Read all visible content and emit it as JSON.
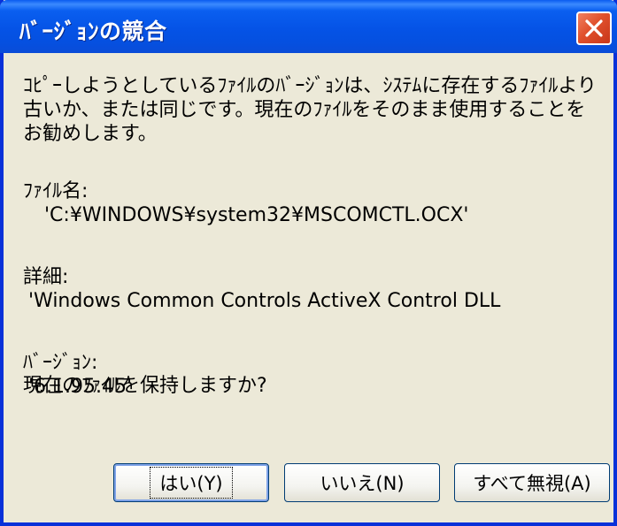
{
  "dialog": {
    "title": "ﾊﾞｰｼﾞｮﾝの競合",
    "message": "ｺﾋﾟｰしようとしているﾌｧｲﾙのﾊﾞｰｼﾞｮﾝは、ｼｽﾃﾑに存在するﾌｧｲﾙより古いか、または同じです。現在のﾌｧｲﾙをそのまま使用することをお勧めします。",
    "file_label": "ﾌｧｲﾙ名:",
    "file_value": "'C:¥WINDOWS¥system32¥MSCOMCTL.OCX'",
    "details_label": "詳細:",
    "details_value": "'Windows Common Controls ActiveX Control DLL",
    "version_label": "ﾊﾞｰｼﾞｮﾝ:",
    "version_value": "'6.1.95.45'",
    "question": "現在のﾌｧｲﾙを保持しますか?"
  },
  "buttons": {
    "yes": "はい(Y)",
    "no": "いいえ(N)",
    "ignore_all": "すべて無視(A)"
  },
  "icons": {
    "close": "close-icon"
  },
  "colors": {
    "titlebar": "#0553e6",
    "close": "#e0502c",
    "background": "#ece9d8"
  }
}
